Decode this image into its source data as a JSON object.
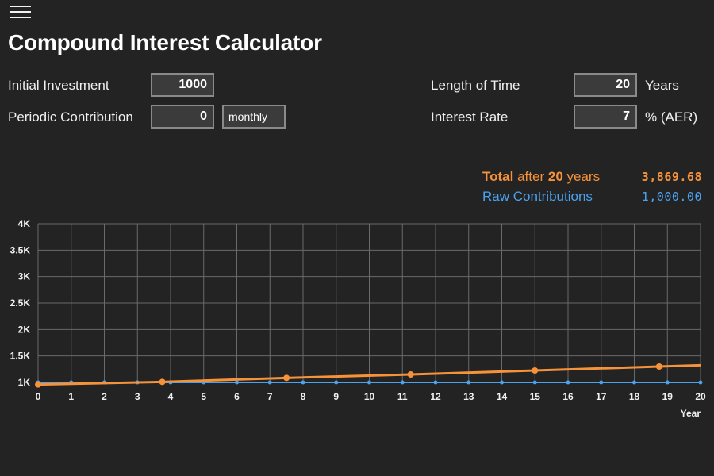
{
  "app": {
    "title": "Compound Interest Calculator"
  },
  "inputs": {
    "initial_investment": {
      "label": "Initial Investment",
      "value": "1000"
    },
    "periodic_contribution": {
      "label": "Periodic Contribution",
      "value": "0",
      "frequency": "monthly"
    },
    "length_of_time": {
      "label": "Length of Time",
      "value": "20",
      "unit": "Years"
    },
    "interest_rate": {
      "label": "Interest Rate",
      "value": "7",
      "unit": "% (AER)"
    }
  },
  "summary": {
    "total_word": "Total",
    "total_mid": "after",
    "years_value": "20",
    "years_word": "years",
    "total_value": "3,869.68",
    "raw_label": "Raw Contributions",
    "raw_value": "1,000.00"
  },
  "colors": {
    "total": "#f5923a",
    "raw": "#4aa3f0",
    "grid": "#6a6a6a",
    "background": "#232323"
  },
  "icons": {
    "menu": "hamburger-menu-icon"
  },
  "chart_data": {
    "type": "line",
    "xlabel": "Year",
    "ylabel": "",
    "xlim": [
      0,
      20
    ],
    "ylim": [
      1000,
      4000
    ],
    "x_ticks": [
      0,
      1,
      2,
      3,
      4,
      5,
      6,
      7,
      8,
      9,
      10,
      11,
      12,
      13,
      14,
      15,
      16,
      17,
      18,
      19,
      20
    ],
    "y_ticks": [
      1000,
      1500,
      2000,
      2500,
      3000,
      3500,
      4000
    ],
    "y_tick_labels": [
      "1K",
      "1.5K",
      "2K",
      "2.5K",
      "3K",
      "3.5K",
      "4K"
    ],
    "grid": true,
    "series": [
      {
        "color": "#f5923a",
        "x": [
          0,
          3.75,
          7.5,
          11.25,
          15,
          18.75,
          20
        ],
        "y": [
          960,
          1010,
          1085,
          1150,
          1225,
          1300,
          1325
        ],
        "markers_x": [
          0,
          3.75,
          7.5,
          11.25,
          15,
          18.75
        ]
      },
      {
        "color": "#4aa3f0",
        "x": [
          0,
          1,
          2,
          3,
          4,
          5,
          6,
          7,
          8,
          9,
          10,
          11,
          12,
          13,
          14,
          15,
          16,
          17,
          18,
          19,
          20
        ],
        "y": [
          1000,
          1000,
          1000,
          1000,
          1000,
          1000,
          1000,
          1000,
          1000,
          1000,
          1000,
          1000,
          1000,
          1000,
          1000,
          1000,
          1000,
          1000,
          1000,
          1000,
          1000
        ]
      }
    ]
  }
}
